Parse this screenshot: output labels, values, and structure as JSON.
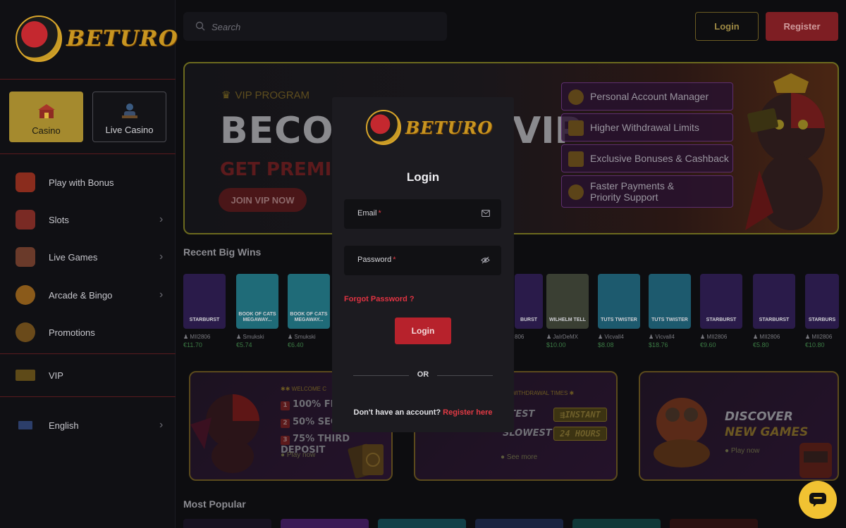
{
  "brand": {
    "name": "BETURO"
  },
  "search": {
    "placeholder": "Search"
  },
  "header": {
    "login_label": "Login",
    "register_label": "Register"
  },
  "sidebar": {
    "tabs": [
      {
        "label": "Casino",
        "active": true
      },
      {
        "label": "Live Casino",
        "active": false
      }
    ],
    "items": [
      {
        "label": "Play with Bonus",
        "icon": "gift-icon",
        "chevron": false
      },
      {
        "label": "Slots",
        "icon": "slot-machine-icon",
        "chevron": true
      },
      {
        "label": "Live Games",
        "icon": "dealer-icon",
        "chevron": true
      },
      {
        "label": "Arcade & Bingo",
        "icon": "arcade-icon",
        "chevron": true
      },
      {
        "label": "Promotions",
        "icon": "promotions-icon",
        "chevron": false
      },
      {
        "label": "VIP",
        "icon": "vip-card-icon",
        "chevron": false
      },
      {
        "label": "English",
        "icon": "uk-flag-icon",
        "chevron": true
      }
    ]
  },
  "banner": {
    "tag": "VIP PROGRAM",
    "title_left": "BECOM",
    "title_right": "VIP",
    "subtitle": "GET PREMIU",
    "cta": "JOIN VIP NOW",
    "perks": [
      "Personal Account Manager",
      "Higher Withdrawal Limits",
      "Exclusive Bonuses & Cashback",
      "Faster Payments & Priority Support"
    ]
  },
  "recent_wins": {
    "title": "Recent Big Wins",
    "items": [
      {
        "game": "STARBURST",
        "user": "MII2806",
        "amount": "€11.70",
        "color": "#2a1b4a"
      },
      {
        "game": "BOOK OF CATS MEGAWAY...",
        "user": "Smukski",
        "amount": "€5.74",
        "color": "#1f6b78"
      },
      {
        "game": "BOOK OF CATS MEGAWAY...",
        "user": "Smukski",
        "amount": "€6.40",
        "color": "#1f6b78"
      },
      {
        "game": "BURST",
        "user": "806",
        "amount": "",
        "color": "#2a1b4a"
      },
      {
        "game": "WILHELM TELL",
        "user": "JaIrDeMX",
        "amount": "$10.00",
        "color": "#3a3f33"
      },
      {
        "game": "TUTS TWISTER",
        "user": "Vicvall4",
        "amount": "$8.08",
        "color": "#1d5a6e"
      },
      {
        "game": "TUTS TWISTER",
        "user": "Vicvall4",
        "amount": "$18.76",
        "color": "#1d5a6e"
      },
      {
        "game": "STARBURST",
        "user": "MII2806",
        "amount": "€9.60",
        "color": "#2a1b4a"
      },
      {
        "game": "STARBURST",
        "user": "MII2806",
        "amount": "€5.80",
        "color": "#2a1b4a"
      },
      {
        "game": "STARBURS",
        "user": "MII2806",
        "amount": "€10.80",
        "color": "#2a1b4a"
      }
    ]
  },
  "promos": {
    "welcome": {
      "tag": "WELCOME C",
      "lines": [
        {
          "num": "1",
          "text": "100% FI"
        },
        {
          "num": "2",
          "text": "50% SEC"
        },
        {
          "num": "3",
          "text": "75% THIRD DEPOSIT"
        }
      ],
      "link": "Play now"
    },
    "withdrawal": {
      "tag": "WITHDRAWAL TIMES",
      "rows": [
        {
          "label": "STEST",
          "value": "INSTANT"
        },
        {
          "label": "SLOWEST",
          "value": "24 HOURS"
        }
      ],
      "link": "See more"
    },
    "discover": {
      "line1": "DISCOVER",
      "line2": "NEW GAMES",
      "link": "Play now"
    }
  },
  "most_popular": {
    "title": "Most Popular"
  },
  "modal": {
    "brand": "BETURO",
    "title": "Login",
    "email_label": "Email",
    "password_label": "Password",
    "required_mark": "*",
    "forgot": "Forgot Password ?",
    "submit": "Login",
    "or": "OR",
    "no_account": "Don't have an account?",
    "register_link": "Register here"
  },
  "colors": {
    "accent_gold": "#c89520",
    "accent_red": "#b7222c",
    "link_red": "#e23a44"
  }
}
